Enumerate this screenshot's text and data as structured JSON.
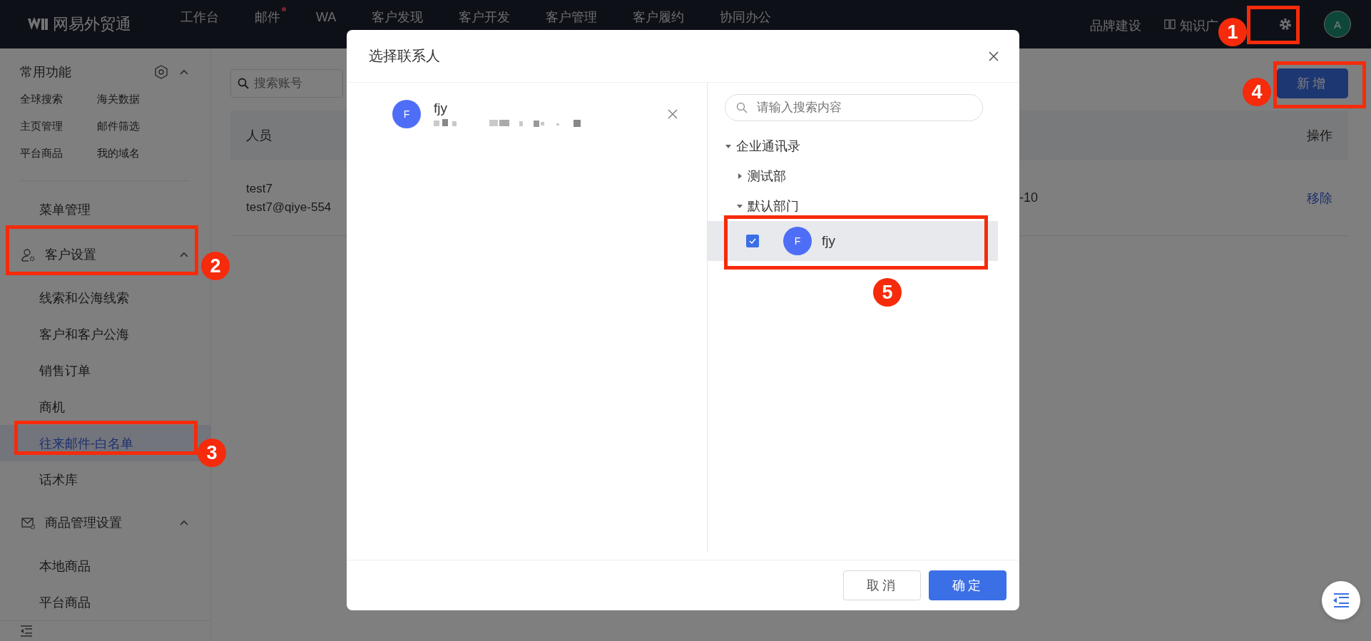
{
  "top_nav": {
    "logo": "网易外贸通",
    "items": [
      {
        "label": "工作台",
        "badge": false
      },
      {
        "label": "邮件",
        "badge": true
      },
      {
        "label": "WA",
        "badge": false
      },
      {
        "label": "客户发现",
        "badge": false
      },
      {
        "label": "客户开发",
        "badge": false
      },
      {
        "label": "客户管理",
        "badge": false
      },
      {
        "label": "客户履约",
        "badge": false
      },
      {
        "label": "协同办公",
        "badge": false
      }
    ],
    "right_items": [
      "品牌建设",
      "知识广"
    ],
    "avatar": "A"
  },
  "sidebar": {
    "common": {
      "title": "常用功能",
      "expanded": true,
      "shortcuts": [
        "全球搜索",
        "海关数据",
        "主页管理",
        "邮件筛选",
        "平台商品",
        "我的域名"
      ]
    },
    "menu": [
      {
        "label": "菜单管理"
      },
      {
        "label": "客户设置",
        "expanded": true,
        "children": [
          {
            "label": "线索和公海线索",
            "selected": false
          },
          {
            "label": "客户和客户公海",
            "selected": false
          },
          {
            "label": "销售订单",
            "selected": false
          },
          {
            "label": "商机",
            "selected": false
          },
          {
            "label": "往来邮件-白名单",
            "selected": true
          },
          {
            "label": "话术库",
            "selected": false
          }
        ]
      },
      {
        "label": "商品管理设置",
        "expanded": true,
        "children": [
          {
            "label": "本地商品",
            "selected": false
          },
          {
            "label": "平台商品",
            "selected": false
          }
        ]
      }
    ]
  },
  "main": {
    "search": {
      "placeholder": "搜索账号"
    },
    "add_button": "新增",
    "table": {
      "columns": [
        "人员",
        "操作"
      ],
      "rows": [
        {
          "person_name": "test7",
          "person_email": "test7@qiye-554",
          "column_3": "-10",
          "action": "移除"
        }
      ]
    }
  },
  "dialog": {
    "title": "选择联系人",
    "selected_contacts": [
      {
        "avatar": "F",
        "name": "fjy"
      }
    ],
    "search": {
      "placeholder": "请输入搜索内容"
    },
    "tree": [
      {
        "label": "企业通讯录",
        "expanded": true,
        "children": [
          {
            "label": "测试部",
            "expanded": false
          },
          {
            "label": "默认部门",
            "expanded": true,
            "contacts": [
              {
                "avatar": "F",
                "name": "fjy",
                "checked": true,
                "selected": true
              }
            ]
          }
        ]
      }
    ],
    "buttons": [
      "取消",
      "确定"
    ]
  },
  "callouts": [
    "1",
    "2",
    "3",
    "4",
    "5"
  ]
}
